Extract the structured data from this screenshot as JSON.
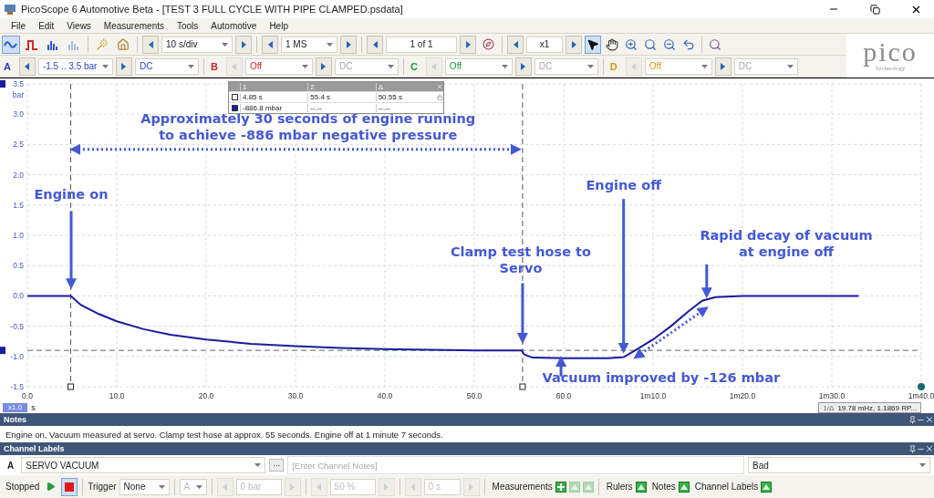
{
  "window": {
    "title": "PicoScope 6 Automotive Beta - [TEST 3 FULL CYCLE WITH PIPE CLAMPED.psdata]"
  },
  "menu": [
    "File",
    "Edit",
    "Views",
    "Measurements",
    "Tools",
    "Automotive",
    "Help"
  ],
  "toolbar": {
    "view_buttons": [
      {
        "kind": "scope",
        "selected": true,
        "disabled": false
      },
      {
        "kind": "persistence",
        "selected": false,
        "disabled": false
      },
      {
        "kind": "spectrum",
        "selected": false,
        "disabled": false
      },
      {
        "kind": "spectrum",
        "selected": false,
        "disabled": true
      },
      {
        "kind": "wand",
        "selected": false,
        "disabled": false
      },
      {
        "kind": "home",
        "selected": false,
        "disabled": false
      }
    ],
    "timebase": "10 s/div",
    "samples": "1 MS",
    "buffer": "1 of 1",
    "zoom": "x1",
    "tools": [
      {
        "kind": "pointer",
        "selected": true
      },
      {
        "kind": "hand",
        "selected": false
      },
      {
        "kind": "zoom-in",
        "selected": false
      },
      {
        "kind": "zoom-area",
        "selected": false
      },
      {
        "kind": "zoom-out",
        "selected": false
      },
      {
        "kind": "undo",
        "selected": false
      },
      {
        "kind": "zoom-fit",
        "selected": false
      }
    ]
  },
  "logo": {
    "name": "pico",
    "tagline": "Technology"
  },
  "channels": [
    {
      "letter": "A",
      "color": "#2b3fc6",
      "enabled": true,
      "range": "-1.5 .. 3.5 bar",
      "coupling": "DC"
    },
    {
      "letter": "B",
      "color": "#d8262b",
      "enabled": false,
      "range": "Off",
      "coupling": "DC"
    },
    {
      "letter": "C",
      "color": "#1d9a3a",
      "enabled": false,
      "range": "Off",
      "coupling": "DC"
    },
    {
      "letter": "D",
      "color": "#d49a17",
      "enabled": false,
      "range": "Off",
      "coupling": "DC"
    }
  ],
  "chart_data": {
    "type": "line",
    "ylabel": "bar",
    "xlabel": "s",
    "xlim": [
      0,
      100
    ],
    "ylim": [
      -1.5,
      3.5
    ],
    "xticks": [
      {
        "value": 0,
        "label": "0.0"
      },
      {
        "value": 10,
        "label": "10.0"
      },
      {
        "value": 20,
        "label": "20.0"
      },
      {
        "value": 30,
        "label": "30.0"
      },
      {
        "value": 40,
        "label": "40.0"
      },
      {
        "value": 50,
        "label": "50.0"
      },
      {
        "value": 60,
        "label": "60.0"
      },
      {
        "value": 70,
        "label": "1m10.0"
      },
      {
        "value": 80,
        "label": "1m20.0"
      },
      {
        "value": 90,
        "label": "1m30.0"
      },
      {
        "value": 100,
        "label": "1m40.0"
      }
    ],
    "yticks": [
      {
        "value": 3.5,
        "label": "3.5"
      },
      {
        "value": 3,
        "label": "3.0"
      },
      {
        "value": 2.5,
        "label": "2.5"
      },
      {
        "value": 2,
        "label": "2.0"
      },
      {
        "value": 1.5,
        "label": "1.5"
      },
      {
        "value": 1,
        "label": "1.0"
      },
      {
        "value": 0.5,
        "label": "0.5"
      },
      {
        "value": 0,
        "label": "0.0"
      },
      {
        "value": -0.5,
        "label": "-0.5"
      },
      {
        "value": -1,
        "label": "-1.0"
      },
      {
        "value": -1.5,
        "label": "-1.5"
      }
    ],
    "x": [
      0,
      4.85,
      5,
      6,
      8,
      10,
      13,
      16,
      20,
      25,
      30,
      35,
      40,
      45,
      50,
      55.3,
      55.6,
      56.5,
      60,
      65,
      66.7,
      68,
      70,
      72,
      74,
      75.5,
      77,
      80,
      85,
      90,
      93
    ],
    "grid": true,
    "series": [
      {
        "color": "#1b1b9e",
        "values": [
          0,
          0,
          -0.02,
          -0.15,
          -0.3,
          -0.42,
          -0.55,
          -0.64,
          -0.72,
          -0.79,
          -0.83,
          -0.86,
          -0.88,
          -0.89,
          -0.9,
          -0.9,
          -0.97,
          -1.02,
          -1.03,
          -1.03,
          -1.01,
          -0.9,
          -0.72,
          -0.5,
          -0.25,
          -0.08,
          -0.02,
          0,
          0,
          0,
          0
        ]
      }
    ],
    "ref_lines": [
      {
        "axis": "x",
        "value": 4.85
      },
      {
        "axis": "x",
        "value": 55.4
      },
      {
        "axis": "y",
        "value": -0.9
      }
    ]
  },
  "callouts": [
    {
      "lines": [
        "Approximately 30 seconds of engine running",
        "to achieve -886 mbar negative pressure"
      ]
    },
    {
      "lines": [
        "Engine on"
      ]
    },
    {
      "lines": [
        "Engine off"
      ]
    },
    {
      "lines": [
        "Clamp test hose to",
        "Servo"
      ]
    },
    {
      "lines": [
        "Rapid decay of vacuum",
        "at engine off"
      ]
    },
    {
      "lines": [
        "Vacuum improved by -126 mbar"
      ]
    }
  ],
  "rulers_table": {
    "columns": [
      "1",
      "2",
      "Δ"
    ],
    "rows": [
      {
        "kind": "time",
        "cells": [
          "4.85 s",
          "55.4 s",
          "50.55 s"
        ]
      },
      {
        "kind": "signal",
        "cells": [
          "-886.8 mbar",
          "--.--",
          "--.--"
        ]
      }
    ]
  },
  "scale_badge": "x1.0",
  "frequency": {
    "label": "1/Δ",
    "value": "19.78 mHz, 1.1869 RP..."
  },
  "notes": {
    "title": "Notes",
    "text": "Engine on, Vacuum measured at servo. Clamp test hose at approx. 55 seconds. Engine off at 1 minute 7 seconds."
  },
  "channel_labels": {
    "title": "Channel Labels",
    "channel": "A",
    "label": "SERVO VACUUM",
    "more": "···",
    "placeholder": "[Enter Channel Notes]",
    "quality": "Bad"
  },
  "status_bar": {
    "status": "Stopped",
    "running": false,
    "trigger_label": "Trigger",
    "trigger_mode": "None",
    "trigger_channel": "A",
    "threshold": "0 bar",
    "pre_trigger": "50 %",
    "delay": "0 s",
    "panels": [
      {
        "label": "Measurements",
        "actions": [
          {
            "kind": "add",
            "disabled": false
          },
          {
            "kind": "toggle",
            "disabled": true
          },
          {
            "kind": "toggle",
            "disabled": true
          }
        ]
      },
      {
        "label": "Rulers",
        "actions": [
          {
            "kind": "toggle",
            "disabled": false
          }
        ]
      },
      {
        "label": "Notes",
        "actions": [
          {
            "kind": "toggle",
            "disabled": false
          }
        ]
      },
      {
        "label": "Channel Labels",
        "actions": [
          {
            "kind": "toggle",
            "disabled": false
          }
        ]
      }
    ]
  }
}
